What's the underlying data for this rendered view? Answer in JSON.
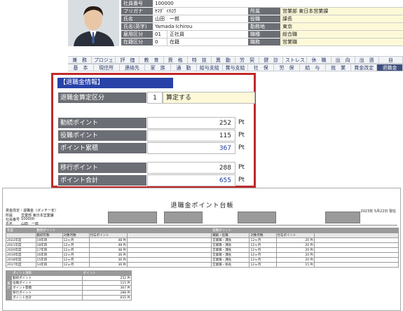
{
  "employee": {
    "photo": "employee-photo",
    "rows": [
      {
        "l": "社員番号",
        "v": "100000",
        "l2": "",
        "v2": ""
      },
      {
        "l": "フリガナ",
        "v": "ﾔﾏﾀﾞ ｲﾁﾛｳ",
        "l2": "所属",
        "v2": "営業部 東日本営業課"
      },
      {
        "l": "氏名",
        "v": "山田　一郎",
        "l2": "役職",
        "v2": "課長"
      },
      {
        "l": "氏名(英字)",
        "v": "Yamada Ichirou",
        "l2": "勤務地",
        "v2": "東京"
      },
      {
        "l": "雇用区分",
        "n": "01",
        "v": "正社員",
        "l2": "職種",
        "v2": "総合職"
      },
      {
        "l": "在籍区分",
        "n": "0",
        "v": "在籍",
        "l2": "職務",
        "v2": "営業職"
      }
    ]
  },
  "tabs1": [
    "兼　務",
    "プロジェ",
    "評　価",
    "教　育",
    "資　格",
    "特　技",
    "異　動",
    "労　契",
    "健　診",
    "ストレス",
    "休　職",
    "出　向",
    "出　張",
    "自"
  ],
  "tabs2": [
    "基　本",
    "現住所",
    "連絡先",
    "家　族",
    "通　勤",
    "給与支給",
    "賞与支給",
    "社　保",
    "労　保",
    "給　与",
    "就　業",
    "賞金改定",
    "退職金"
  ],
  "panel": {
    "title": "【退職金情報】",
    "calc_label": "退職金算定区分",
    "calc_num": "1",
    "calc_text": "算定する",
    "rows1": [
      {
        "label": "勤続ポイント",
        "value": "252",
        "unit": "Pt"
      },
      {
        "label": "役職ポイント",
        "value": "115",
        "unit": "Pt"
      },
      {
        "label": "ポイント累積",
        "value": "367",
        "unit": "Pt"
      }
    ],
    "rows2": [
      {
        "label": "移行ポイント",
        "value": "288",
        "unit": "Pt"
      },
      {
        "label": "ポイント合計",
        "value": "655",
        "unit": "Pt"
      }
    ]
  },
  "doc": {
    "title": "退職金ポイント台帳",
    "date": "2023年 5月22日 現在",
    "h1": "賃金改定・退職金（ポッチ一年）",
    "dept": "営業部 東日本営業課",
    "emp_no": "100000",
    "name": "山田　一郎",
    "lbl_dept": "所属",
    "lbl_no": "社員番号",
    "lbl_name": "氏名",
    "sect1": "年度",
    "sect_kinzoku": "勤続ポイント",
    "sect_yakushoku": "役職ポイント",
    "cols1": [
      "勤続年数",
      "対象月数",
      "付与ポイント"
    ],
    "cols2": [
      "職級・役職",
      "対象月数",
      "付与ポイント"
    ],
    "rows": [
      {
        "y": "2022年度",
        "k": "19年目",
        "m": "12ヶ月",
        "p": "48 Pt",
        "r": "営業職・課長",
        "rm": "12ヶ月",
        "rp": "20 Pt"
      },
      {
        "y": "2021年度",
        "k": "18年目",
        "m": "12ヶ月",
        "p": "48 Pt",
        "r": "営業職・課長",
        "rm": "12ヶ月",
        "rp": "20 Pt"
      },
      {
        "y": "2020年度",
        "k": "17年目",
        "m": "12ヶ月",
        "p": "48 Pt",
        "r": "営業職・課長",
        "rm": "12ヶ月",
        "rp": "20 Pt"
      },
      {
        "y": "2019年度",
        "k": "16年目",
        "m": "12ヶ月",
        "p": "36 Pt",
        "r": "営業職・課長",
        "rm": "12ヶ月",
        "rp": "20 Pt"
      },
      {
        "y": "2018年度",
        "k": "15年目",
        "m": "12ヶ月",
        "p": "36 Pt",
        "r": "営業職・課長",
        "rm": "12ヶ月",
        "rp": "20 Pt"
      },
      {
        "y": "2017年度",
        "k": "14年目",
        "m": "12ヶ月",
        "p": "36 Pt",
        "r": "営業職・係長",
        "rm": "12ヶ月",
        "rp": "15 Pt"
      }
    ],
    "sum_side": "集計",
    "sum_head1": "ポイント項目",
    "sum_head2": "ポイント",
    "sum": [
      {
        "l": "勤続ポイント",
        "v": "252 Pt"
      },
      {
        "l": "役職ポイント",
        "v": "115 Pt"
      },
      {
        "l": "ポイント累積",
        "v": "367 Pt"
      },
      {
        "l": "移行ポイント",
        "v": "288 Pt"
      },
      {
        "l": "ポイント合計",
        "v": "655 Pt"
      }
    ]
  }
}
